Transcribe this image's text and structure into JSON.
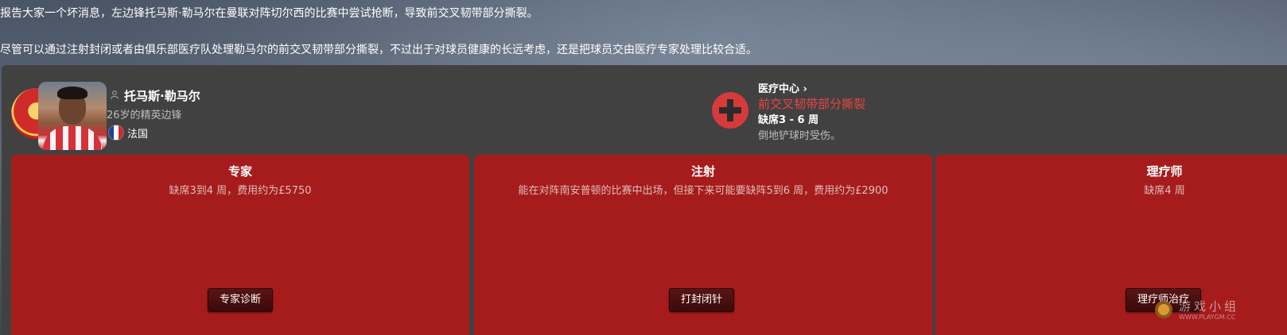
{
  "news": {
    "line1": "报告大家一个坏消息，左边锋托马斯·勒马尔在曼联对阵切尔西的比赛中尝试抢断，导致前交叉韧带部分撕裂。",
    "line2": "尽管可以通过注射封闭或者由俱乐部医疗队处理勒马尔的前交叉韧带部分撕裂，不过出于对球员健康的长远考虑，还是把球员交由医疗专家处理比较合适。"
  },
  "player": {
    "name": "托马斯·勒马尔",
    "description": "26岁的精英边锋",
    "nationality": "法国"
  },
  "injury": {
    "medical_center_link": "医疗中心 ›",
    "name": "前交叉韧带部分撕裂",
    "absence": "缺席3 - 6 周",
    "cause": "倒地铲球时受伤。"
  },
  "options": [
    {
      "title": "专家",
      "description": "缺席3到4 周，费用约为£5750",
      "button": "专家诊断"
    },
    {
      "title": "注射",
      "description": "能在对阵南安普顿的比赛中出场，但接下来可能要缺阵5到6 周，费用约为£2900",
      "button": "打封闭针"
    },
    {
      "title": "理疗师",
      "description": "缺席4 周",
      "button": "理疗师治疗"
    }
  ],
  "watermark": {
    "text": "游戏小组",
    "url": "WWW.PLAYGM.CC"
  },
  "colors": {
    "card": "#a61c1c",
    "injury_text": "#e84545",
    "panel": "#414141"
  },
  "icons": [
    "person-icon",
    "france-flag-icon",
    "medical-cross-icon",
    "chevron-right-icon"
  ]
}
